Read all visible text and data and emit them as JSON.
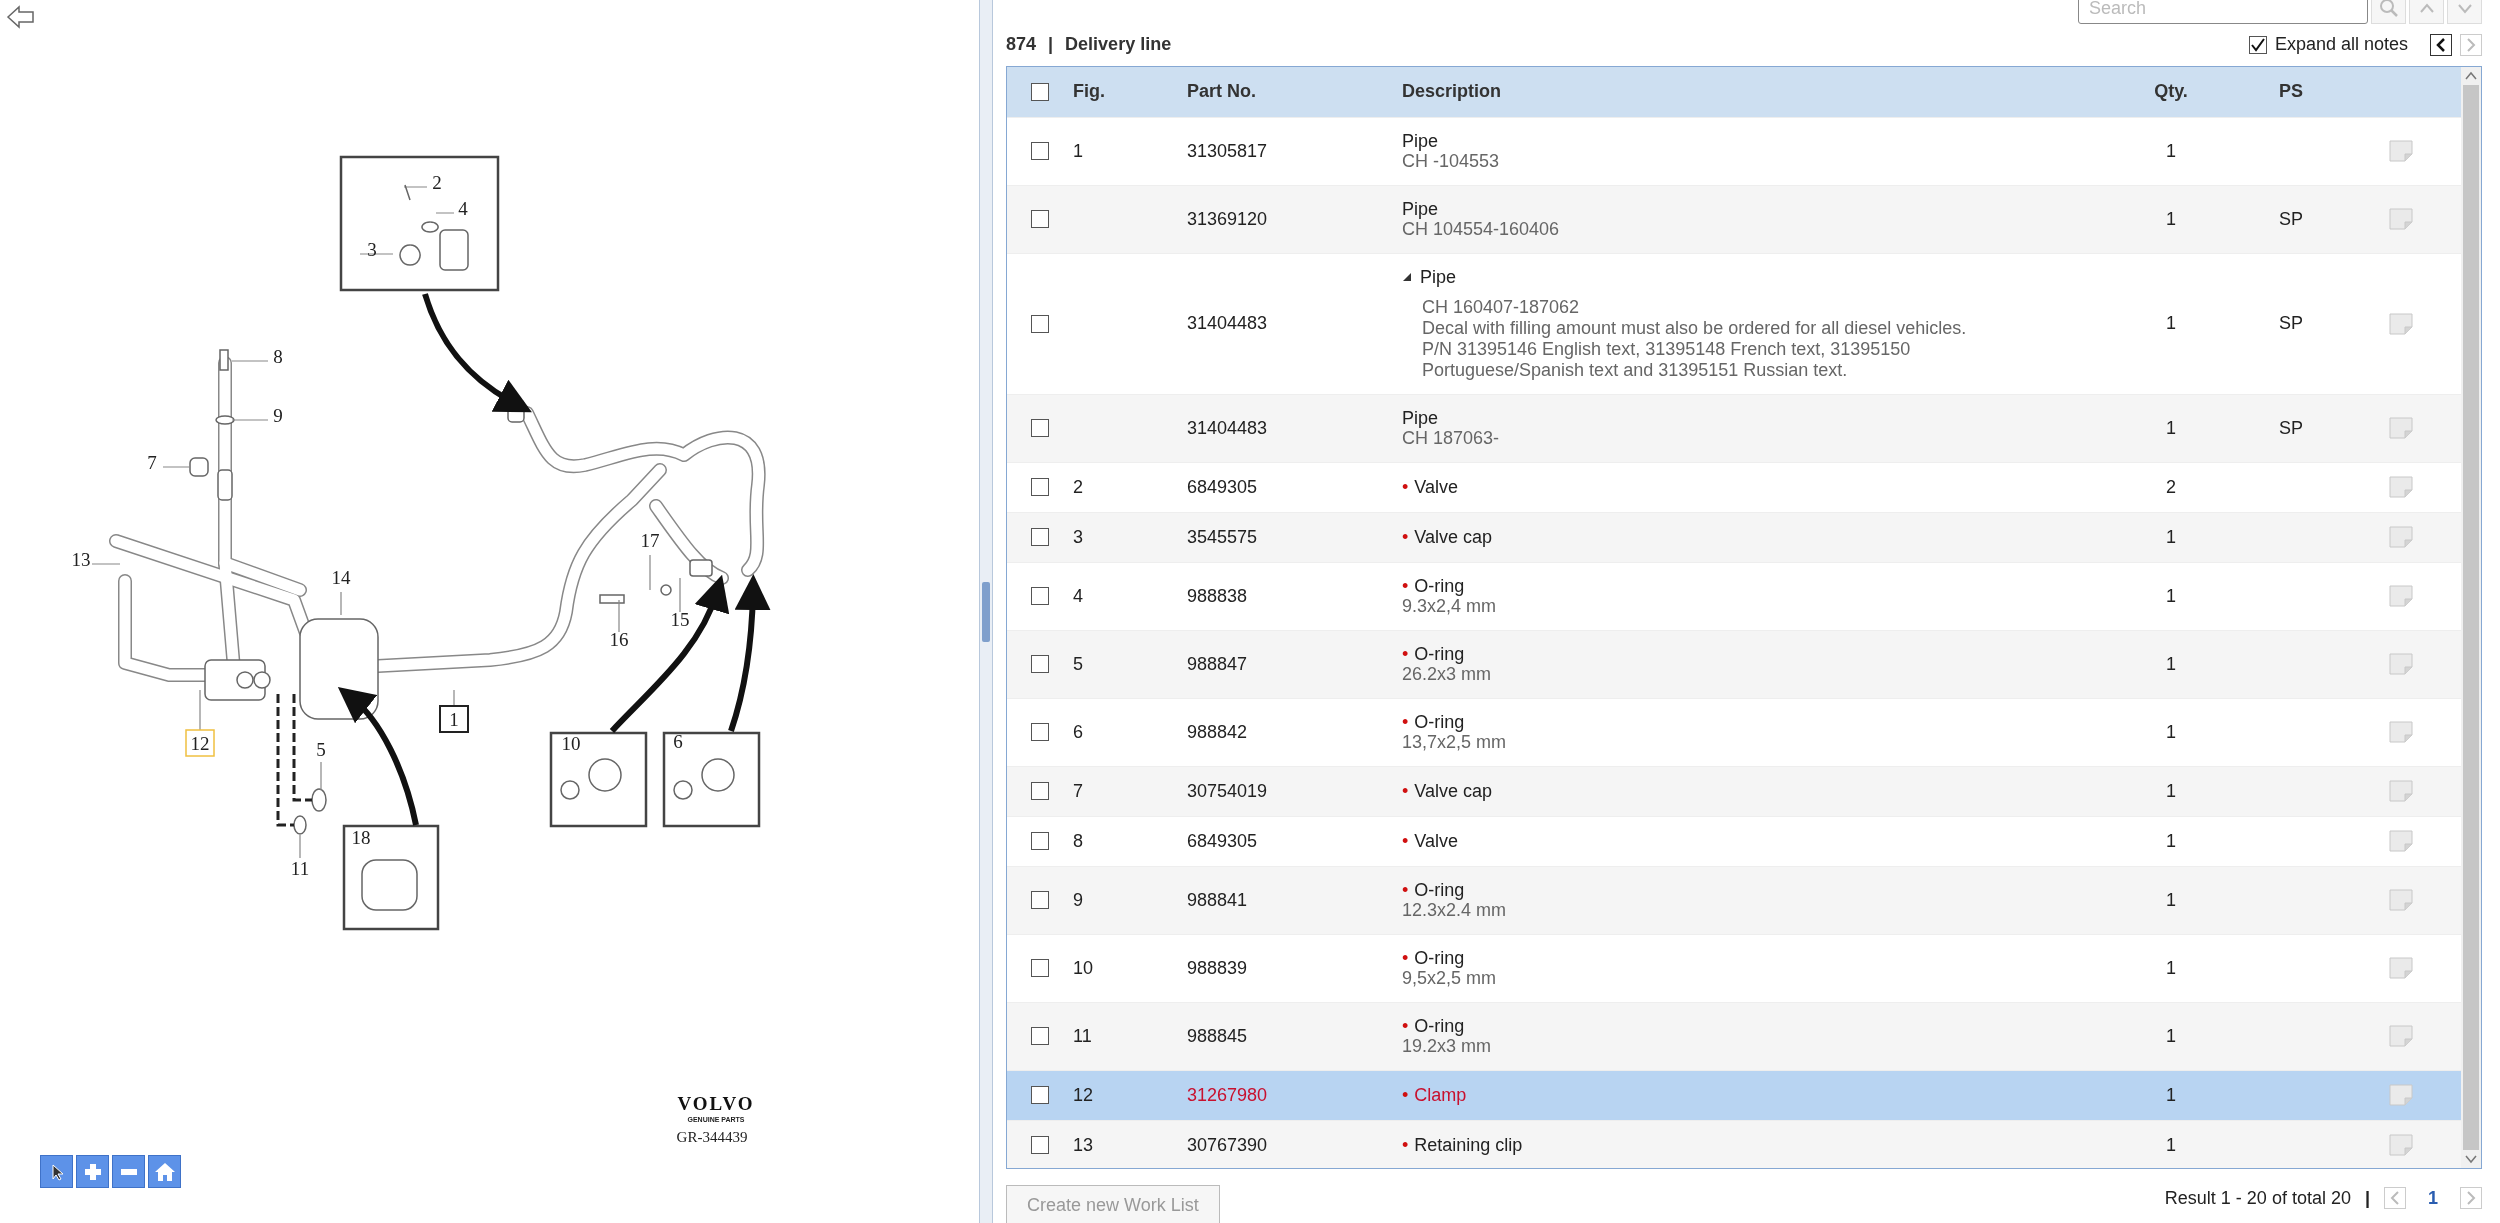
{
  "diagram": {
    "callouts": [
      {
        "label": "2",
        "kind": "plain",
        "selected": false
      },
      {
        "label": "4",
        "kind": "plain",
        "selected": false
      },
      {
        "label": "3",
        "kind": "plain",
        "selected": false
      },
      {
        "label": "8",
        "kind": "plain",
        "selected": false
      },
      {
        "label": "9",
        "kind": "plain",
        "selected": false
      },
      {
        "label": "7",
        "kind": "plain",
        "selected": false
      },
      {
        "label": "13",
        "kind": "plain",
        "selected": false
      },
      {
        "label": "14",
        "kind": "plain",
        "selected": false
      },
      {
        "label": "17",
        "kind": "plain",
        "selected": false
      },
      {
        "label": "15",
        "kind": "plain",
        "selected": false
      },
      {
        "label": "16",
        "kind": "plain",
        "selected": false
      },
      {
        "label": "1",
        "kind": "boxed",
        "selected": false
      },
      {
        "label": "12",
        "kind": "plain",
        "selected": true
      },
      {
        "label": "5",
        "kind": "plain",
        "selected": false
      },
      {
        "label": "11",
        "kind": "plain",
        "selected": false
      },
      {
        "label": "10",
        "kind": "plain",
        "selected": false
      },
      {
        "label": "6",
        "kind": "plain",
        "selected": false
      },
      {
        "label": "18",
        "kind": "plain",
        "selected": false
      }
    ],
    "logo": {
      "brand": "VOLVO",
      "tagline": "GENUINE PARTS"
    },
    "code": "GR-344439",
    "toolbar": [
      {
        "kind": "pointer"
      },
      {
        "kind": "zoom-in"
      },
      {
        "kind": "zoom-out"
      },
      {
        "kind": "home"
      }
    ]
  },
  "search": {
    "placeholder": "Search"
  },
  "heading": {
    "number": "874",
    "separator": "|",
    "title": "Delivery line"
  },
  "expand_all_notes": {
    "label": "Expand all notes",
    "checked": true
  },
  "table": {
    "select_all": {
      "checked": false
    },
    "columns": [
      "Fig.",
      "Part No.",
      "Description",
      "Qty.",
      "PS"
    ],
    "rows": [
      {
        "checked": false,
        "selected": false,
        "fig": "1",
        "part_no": "31305817",
        "description": "Pipe",
        "notes": [
          "CH -104553"
        ],
        "qty": "1"
      },
      {
        "checked": false,
        "selected": false,
        "part_no": "31369120",
        "description": "Pipe",
        "notes": [
          "CH 104554-160406"
        ],
        "qty": "1",
        "ps": "SP"
      },
      {
        "checked": false,
        "selected": false,
        "part_no": "31404483",
        "description": "Pipe",
        "expanded": true,
        "notes": [
          "CH 160407-187062",
          "Decal with filling amount must also be ordered for all diesel vehicles. P/N 31395146 English text, 31395148 French text, 31395150 Portuguese/Spanish text and 31395151 Russian text."
        ],
        "qty": "1",
        "ps": "SP"
      },
      {
        "checked": false,
        "selected": false,
        "part_no": "31404483",
        "description": "Pipe",
        "notes": [
          "CH 187063-"
        ],
        "qty": "1",
        "ps": "SP"
      },
      {
        "checked": false,
        "selected": false,
        "fig": "2",
        "part_no": "6849305",
        "marker": "•",
        "description": "Valve",
        "qty": "2"
      },
      {
        "checked": false,
        "selected": false,
        "fig": "3",
        "part_no": "3545575",
        "marker": "•",
        "description": "Valve cap",
        "qty": "1"
      },
      {
        "checked": false,
        "selected": false,
        "fig": "4",
        "part_no": "988838",
        "marker": "•",
        "description": "O-ring",
        "notes": [
          "9.3x2,4 mm"
        ],
        "qty": "1"
      },
      {
        "checked": false,
        "selected": false,
        "fig": "5",
        "part_no": "988847",
        "marker": "•",
        "description": "O-ring",
        "notes": [
          "26.2x3 mm"
        ],
        "qty": "1"
      },
      {
        "checked": false,
        "selected": false,
        "fig": "6",
        "part_no": "988842",
        "marker": "•",
        "description": "O-ring",
        "notes": [
          "13,7x2,5 mm"
        ],
        "qty": "1"
      },
      {
        "checked": false,
        "selected": false,
        "fig": "7",
        "part_no": "30754019",
        "marker": "•",
        "description": "Valve cap",
        "qty": "1"
      },
      {
        "checked": false,
        "selected": false,
        "fig": "8",
        "part_no": "6849305",
        "marker": "•",
        "description": "Valve",
        "qty": "1"
      },
      {
        "checked": false,
        "selected": false,
        "fig": "9",
        "part_no": "988841",
        "marker": "•",
        "description": "O-ring",
        "notes": [
          "12.3x2.4 mm"
        ],
        "qty": "1"
      },
      {
        "checked": false,
        "selected": false,
        "fig": "10",
        "part_no": "988839",
        "marker": "•",
        "description": "O-ring",
        "notes": [
          "9,5x2,5 mm"
        ],
        "qty": "1"
      },
      {
        "checked": false,
        "selected": false,
        "fig": "11",
        "part_no": "988845",
        "marker": "•",
        "description": "O-ring",
        "notes": [
          "19.2x3 mm"
        ],
        "qty": "1"
      },
      {
        "checked": false,
        "selected": true,
        "fig": "12",
        "part_no": "31267980",
        "marker": "•",
        "description": "Clamp",
        "qty": "1"
      },
      {
        "checked": false,
        "selected": false,
        "fig": "13",
        "part_no": "30767390",
        "marker": "•",
        "description": "Retaining clip",
        "qty": "1"
      }
    ]
  },
  "footer": {
    "create_button": {
      "label": "Create new Work List",
      "disabled": true
    },
    "result": "Result 1 - 20 of total 20",
    "separator": "|",
    "page": "1"
  }
}
